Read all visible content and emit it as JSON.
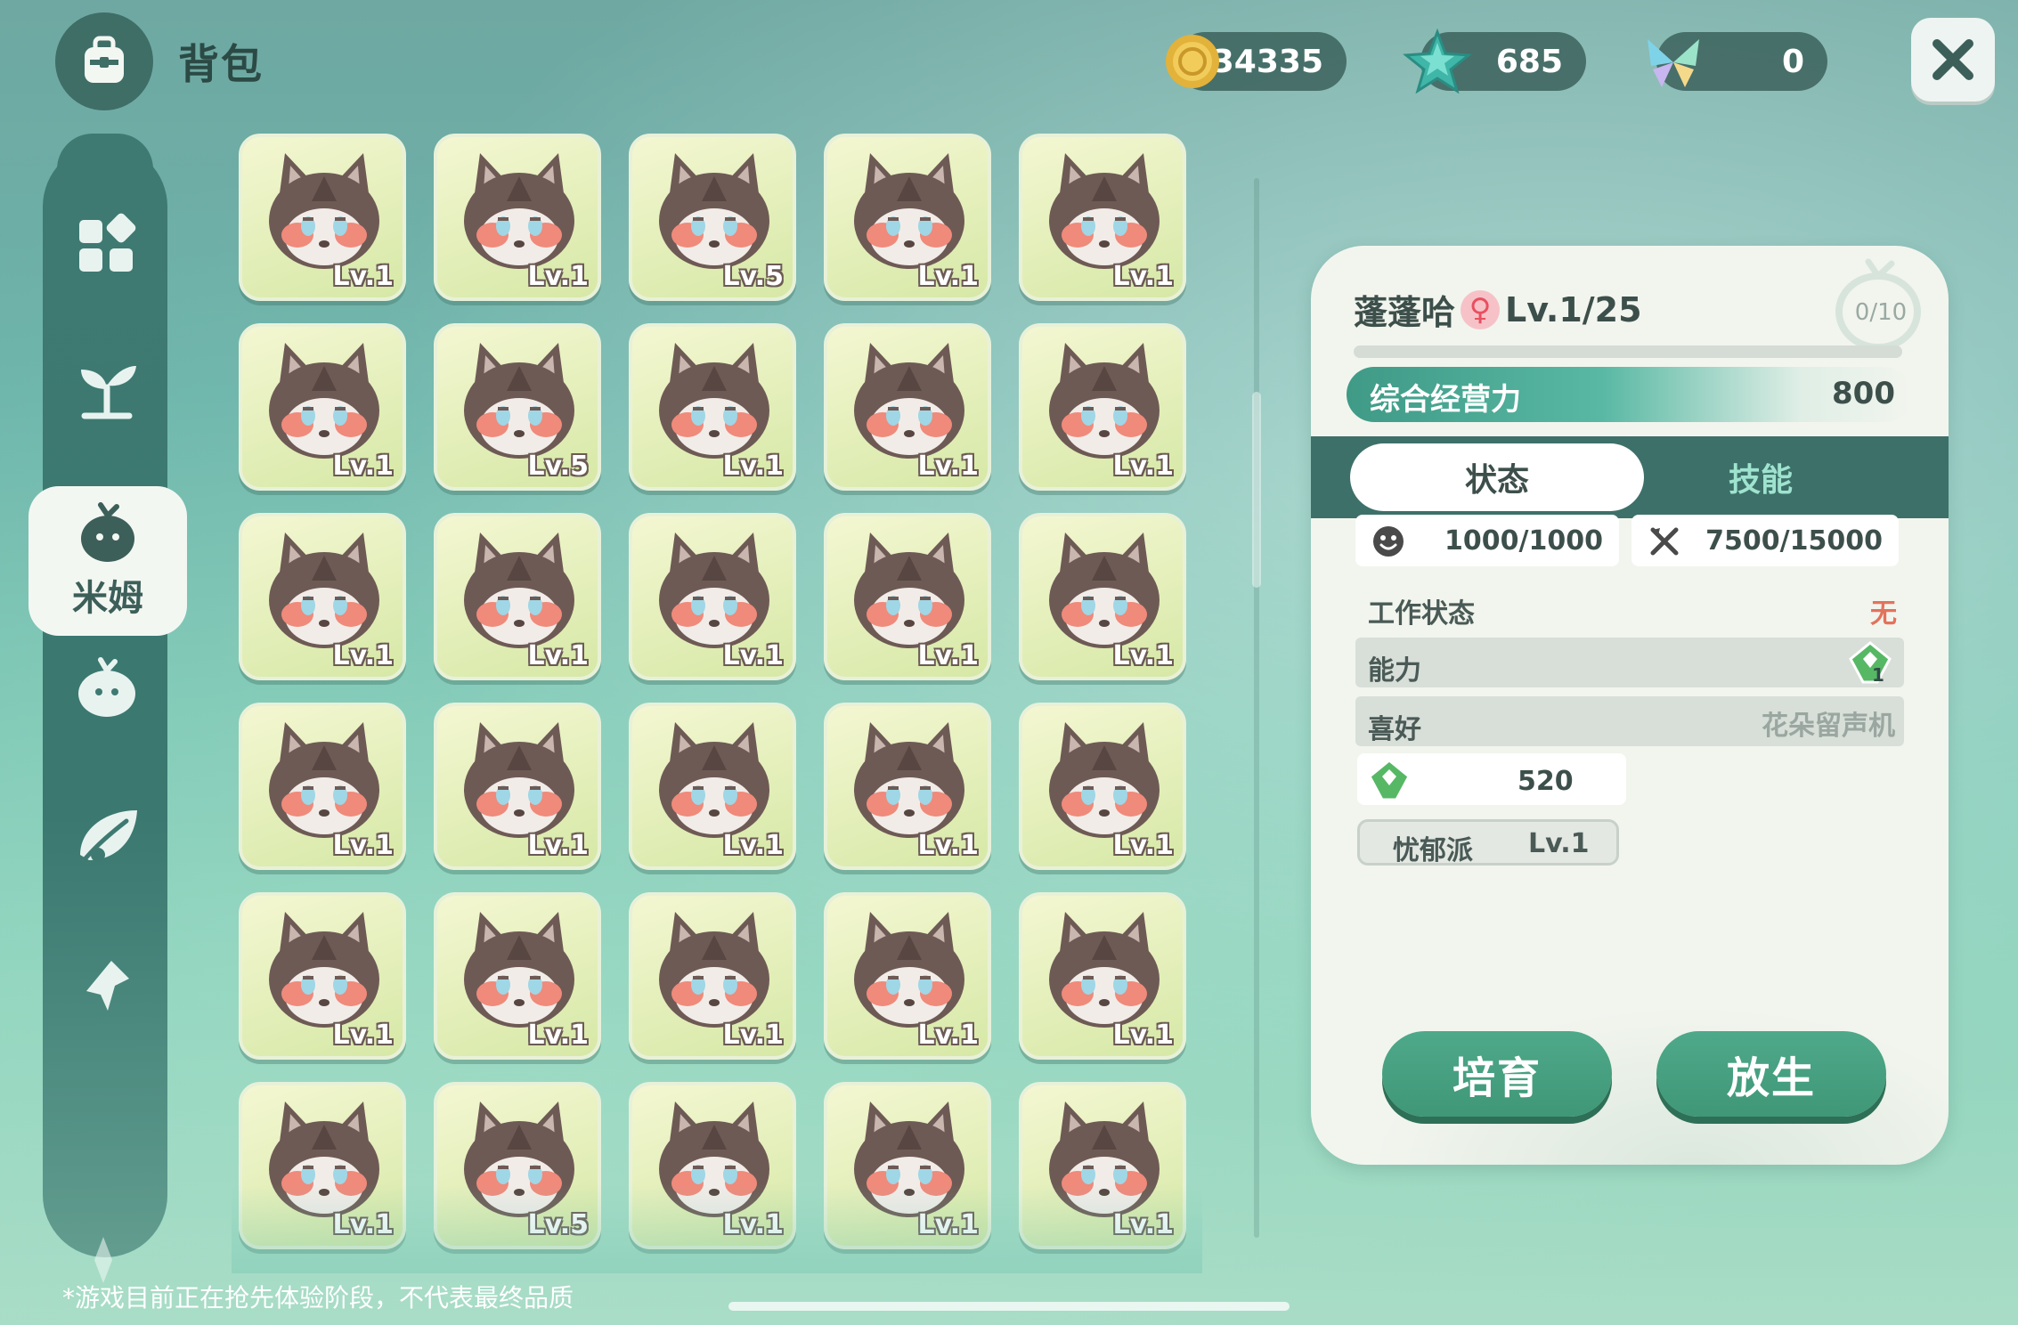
{
  "header": {
    "title": "背包"
  },
  "currency": {
    "coins": "34335",
    "stars": "685",
    "gems": "0"
  },
  "sidebar": {
    "items": [
      {
        "icon": "grid-icon"
      },
      {
        "icon": "sprout-icon"
      },
      {
        "icon": "fruit-icon",
        "label": "米姆",
        "active": true
      },
      {
        "icon": "blob-icon"
      },
      {
        "icon": "leaf-icon"
      },
      {
        "icon": "pin-icon"
      }
    ]
  },
  "grid": {
    "cells": [
      {
        "level": "Lv.1"
      },
      {
        "level": "Lv.1"
      },
      {
        "level": "Lv.5"
      },
      {
        "level": "Lv.1"
      },
      {
        "level": "Lv.1"
      },
      {
        "level": "Lv.1"
      },
      {
        "level": "Lv.5"
      },
      {
        "level": "Lv.1"
      },
      {
        "level": "Lv.1"
      },
      {
        "level": "Lv.1"
      },
      {
        "level": "Lv.1"
      },
      {
        "level": "Lv.1"
      },
      {
        "level": "Lv.1"
      },
      {
        "level": "Lv.1"
      },
      {
        "level": "Lv.1"
      },
      {
        "level": "Lv.1"
      },
      {
        "level": "Lv.1"
      },
      {
        "level": "Lv.1"
      },
      {
        "level": "Lv.1"
      },
      {
        "level": "Lv.1"
      },
      {
        "level": "Lv.1"
      },
      {
        "level": "Lv.1"
      },
      {
        "level": "Lv.1"
      },
      {
        "level": "Lv.1"
      },
      {
        "level": "Lv.1"
      },
      {
        "level": "Lv.1"
      },
      {
        "level": "Lv.5"
      },
      {
        "level": "Lv.1"
      },
      {
        "level": "Lv.1"
      },
      {
        "level": "Lv.1"
      }
    ]
  },
  "detail": {
    "name": "蓬蓬哈",
    "gender_symbol": "♀",
    "level": "Lv.1/25",
    "fruit_count": "0/10",
    "power_label": "综合经营力",
    "power_value": "800",
    "tabs": {
      "status": "状态",
      "skills": "技能"
    },
    "mood": "1000/1000",
    "food": "7500/15000",
    "work_label": "工作状态",
    "work_value": "无",
    "ability_label": "能力",
    "ability_badge": "1",
    "preference_label": "喜好",
    "preference_value": "花朵留声机",
    "ability_value": "520",
    "trait_name": "忧郁派",
    "trait_level": "Lv.1",
    "button_train": "培育",
    "button_release": "放生"
  },
  "footer": {
    "disclaimer": "*游戏目前正在抢先体验阶段，不代表最终品质"
  },
  "colors": {
    "accent": "#3f9777",
    "sidebar": "#3f7a72",
    "panel": "#f2f5ee",
    "alert": "#e2735c"
  }
}
